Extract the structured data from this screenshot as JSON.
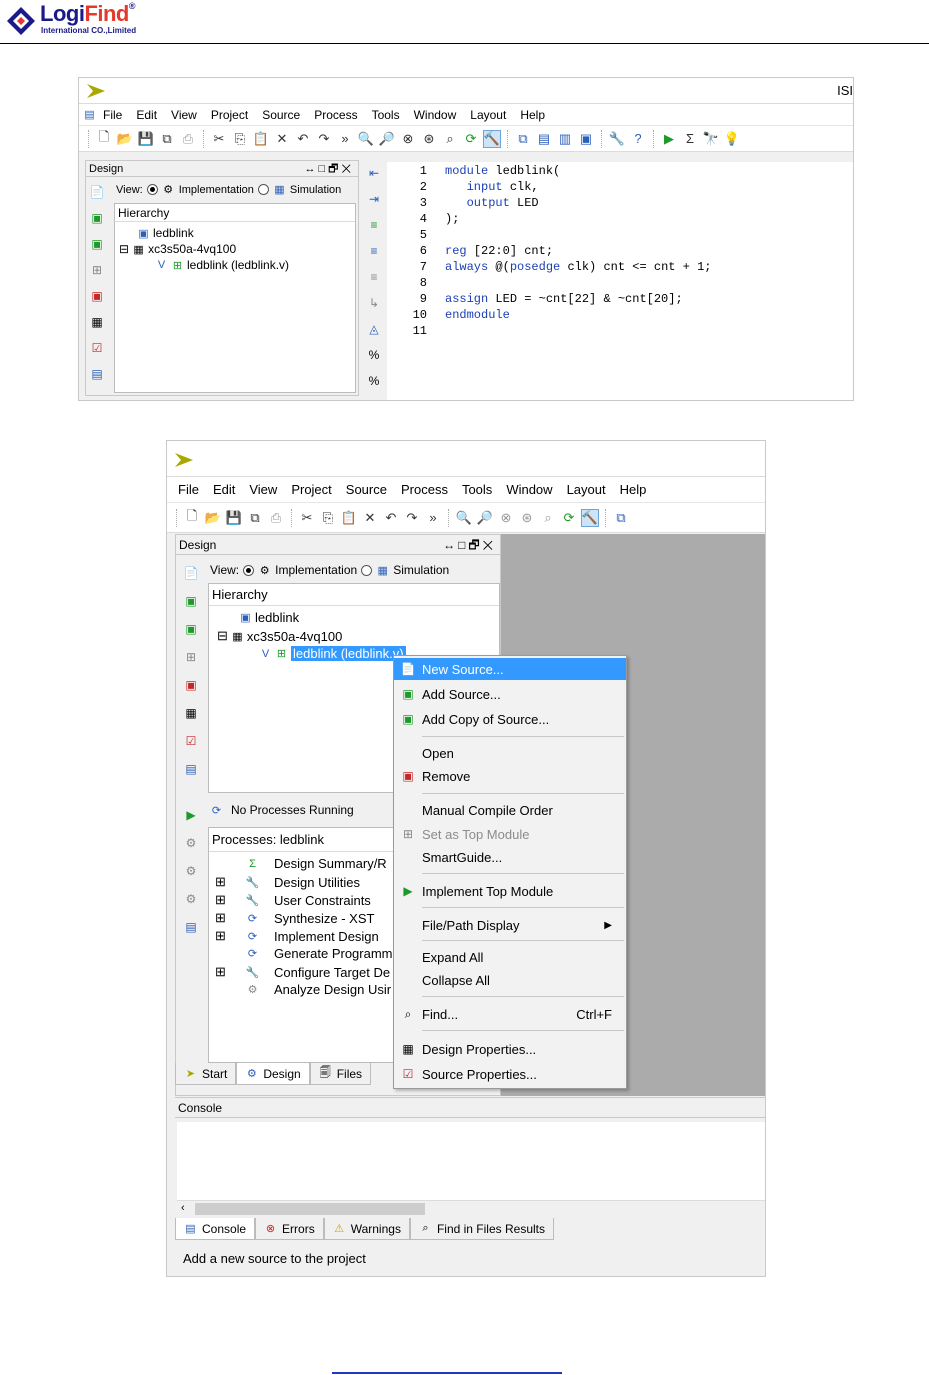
{
  "logo": {
    "name_a": "Logi",
    "name_b": "Find",
    "reg": "®",
    "subtitle": "International CO.,Limited"
  },
  "screenshot1": {
    "title": "ISI",
    "menu": [
      "File",
      "Edit",
      "View",
      "Project",
      "Source",
      "Process",
      "Tools",
      "Window",
      "Layout",
      "Help"
    ],
    "design_panel": {
      "title": "Design",
      "view_label": "View:",
      "implementation": "Implementation",
      "simulation": "Simulation",
      "hierarchy": "Hierarchy",
      "tree": [
        "ledblink",
        "xc3s50a-4vq100",
        "ledblink (ledblink.v)"
      ]
    },
    "code": [
      {
        "n": "1",
        "t": "module ledblink("
      },
      {
        "n": "2",
        "t": "   input clk,"
      },
      {
        "n": "3",
        "t": "   output LED"
      },
      {
        "n": "4",
        "t": ");"
      },
      {
        "n": "5",
        "t": ""
      },
      {
        "n": "6",
        "t": "reg [22:0] cnt;"
      },
      {
        "n": "7",
        "t": "always @(posedge clk) cnt <= cnt + 1;"
      },
      {
        "n": "8",
        "t": ""
      },
      {
        "n": "9",
        "t": "assign LED = ~cnt[22] & ~cnt[20];"
      },
      {
        "n": "10",
        "t": "endmodule"
      },
      {
        "n": "11",
        "t": ""
      }
    ]
  },
  "screenshot2": {
    "menu": [
      "File",
      "Edit",
      "View",
      "Project",
      "Source",
      "Process",
      "Tools",
      "Window",
      "Layout",
      "Help"
    ],
    "design_panel": {
      "title": "Design",
      "view_label": "View:",
      "implementation": "Implementation",
      "simulation": "Simulation",
      "hierarchy": "Hierarchy",
      "tree": [
        "ledblink",
        "xc3s50a-4vq100",
        "ledblink (ledblink.v)"
      ]
    },
    "processes": {
      "status": "No Processes Running",
      "header": "Processes: ledblink",
      "items": [
        "Design Summary/R",
        "Design Utilities",
        "User Constraints",
        "Synthesize - XST",
        "Implement Design",
        "Generate Programm",
        "Configure Target De",
        "Analyze Design Usir"
      ]
    },
    "context_menu": {
      "new_source": "New Source...",
      "add_source": "Add Source...",
      "add_copy": "Add Copy of Source...",
      "open": "Open",
      "remove": "Remove",
      "manual_compile": "Manual Compile Order",
      "set_top": "Set as Top Module",
      "smartguide": "SmartGuide...",
      "implement_top": "Implement Top Module",
      "file_path": "File/Path Display",
      "expand_all": "Expand All",
      "collapse_all": "Collapse All",
      "find": "Find...",
      "find_shortcut": "Ctrl+F",
      "design_props": "Design Properties...",
      "source_props": "Source Properties..."
    },
    "panel_tabs": [
      "Start",
      "Design",
      "Files"
    ],
    "console": {
      "title": "Console"
    },
    "console_tabs": [
      "Console",
      "Errors",
      "Warnings",
      "Find in Files Results"
    ],
    "status": "Add a new source to the project"
  }
}
